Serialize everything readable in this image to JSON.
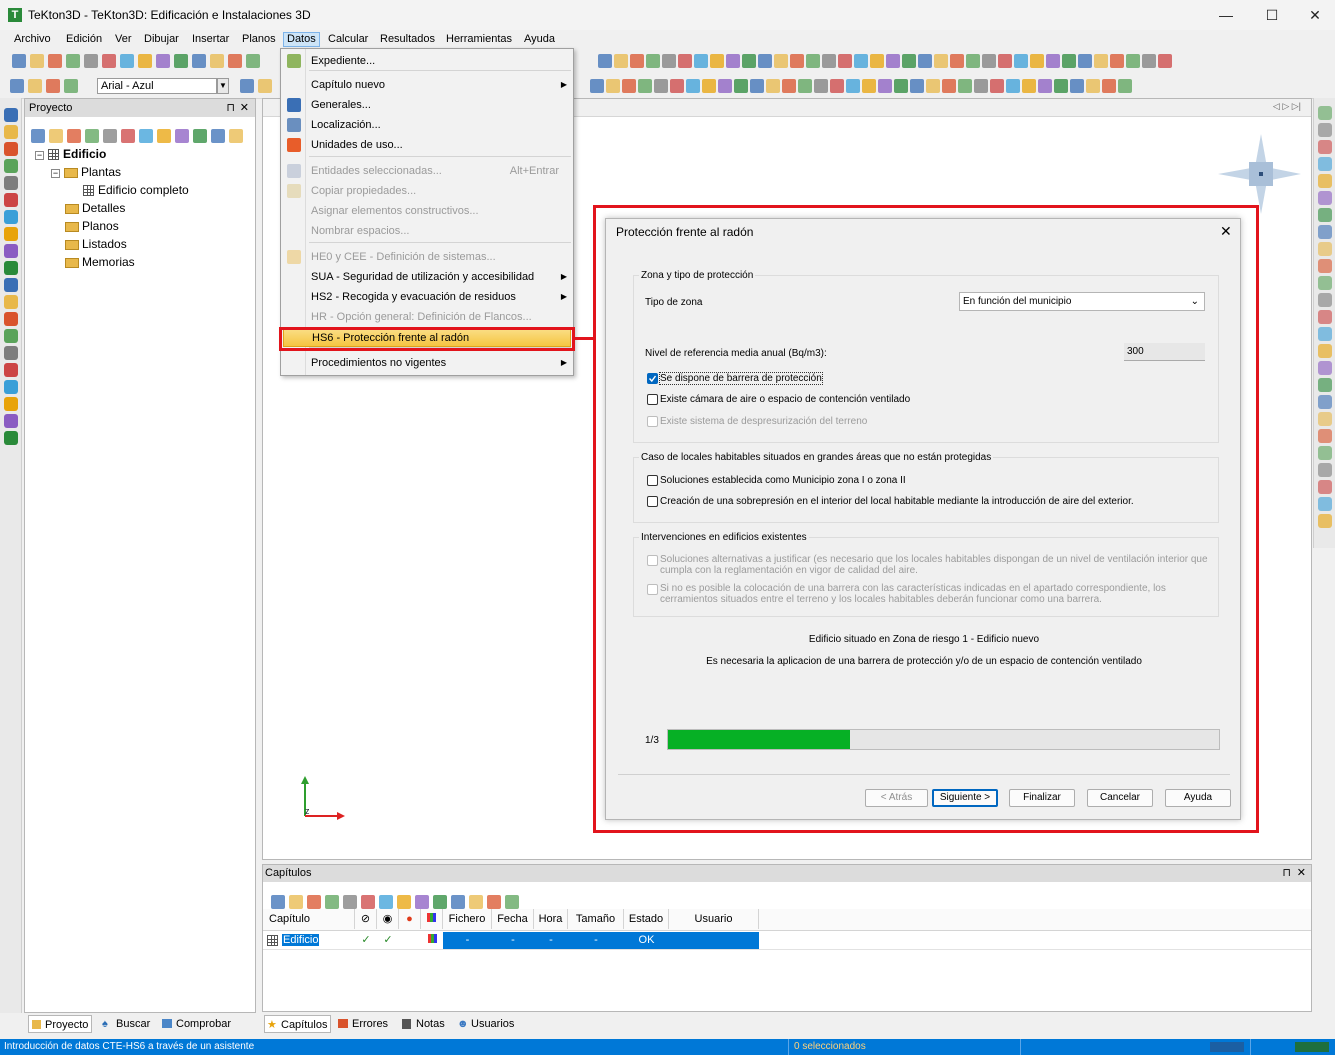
{
  "window": {
    "title": "TeKton3D - TeKton3D: Edificación e Instalaciones 3D",
    "minimize": "—",
    "maximize": "☐",
    "close": "✕"
  },
  "menubar": [
    "Archivo",
    "Edición",
    "Ver",
    "Dibujar",
    "Insertar",
    "Planos",
    "Datos",
    "Calcular",
    "Resultados",
    "Herramientas",
    "Ayuda"
  ],
  "toolbar": {
    "font_select": "Arial - Azul"
  },
  "project_panel": {
    "title": "Proyecto",
    "tree": {
      "root": "Edificio",
      "plantas": "Plantas",
      "edificio_completo": "Edificio completo",
      "detalles": "Detalles",
      "planos": "Planos",
      "listados": "Listados",
      "memorias": "Memorias"
    }
  },
  "datos_menu": {
    "items": [
      {
        "label": "Expediente...",
        "disabled": false
      },
      {
        "label": "Capítulo nuevo",
        "disabled": false,
        "submenu": true
      },
      {
        "label": "Generales...",
        "disabled": false
      },
      {
        "label": "Localización...",
        "disabled": false
      },
      {
        "label": "Unidades de uso...",
        "disabled": false
      },
      {
        "label": "Entidades seleccionadas...",
        "disabled": true,
        "shortcut": "Alt+Entrar"
      },
      {
        "label": "Copiar propiedades...",
        "disabled": true
      },
      {
        "label": "Asignar elementos constructivos...",
        "disabled": true
      },
      {
        "label": "Nombrar espacios...",
        "disabled": true
      },
      {
        "label": "HE0 y CEE - Definición de sistemas...",
        "disabled": true
      },
      {
        "label": "SUA - Seguridad de utilización y accesibilidad",
        "disabled": false,
        "submenu": true
      },
      {
        "label": "HS2 - Recogida y evacuación de residuos",
        "disabled": false,
        "submenu": true
      },
      {
        "label": "HR - Opción general: Definición de Flancos...",
        "disabled": true
      },
      {
        "label": "HS6 - Protección frente al radón",
        "disabled": false,
        "highlighted": true
      },
      {
        "label": "Procedimientos no vigentes",
        "disabled": false,
        "submenu": true
      }
    ]
  },
  "dialog": {
    "title": "Protección frente al radón",
    "group1": {
      "title": "Zona y tipo de protección",
      "tipo_zona_label": "Tipo de zona",
      "tipo_zona_value": "En función del municipio",
      "nivel_label": "Nivel de referencia media anual (Bq/m3):",
      "nivel_value": "300",
      "cb1": "Se dispone de barrera de protección",
      "cb2": "Existe cámara de aire o espacio de contención ventilado",
      "cb3": "Existe sistema de despresurización del terreno"
    },
    "group2": {
      "title": "Caso de locales habitables situados en grandes áreas que no están protegidas",
      "cb1": "Soluciones establecida como Municipio zona I o zona II",
      "cb2": "Creación de una sobrepresión en el interior del local habitable mediante la introducción de aire del exterior."
    },
    "group3": {
      "title": "Intervenciones en edificios existentes",
      "cb1_line1": "Soluciones alternativas a justificar (es necesario que los locales habitables dispongan de un nivel de ventilación interior que",
      "cb1_line2": "cumpla con la reglamentación en vigor de calidad del aire.",
      "cb2_line1": "Si no es posible la colocación de una barrera con las características indicadas en el apartado correspondiente, los",
      "cb2_line2": "cerramientos situados entre el terreno y los locales habitables deberán funcionar como una barrera."
    },
    "info1": "Edificio situado en Zona de riesgo 1 - Edificio nuevo",
    "info2": "Es necesaria la aplicacion de una barrera de protección y/o de un espacio de contención ventilado",
    "progress_label": "1/3",
    "progress_fraction": 0.33,
    "buttons": {
      "back": "< Atrás",
      "next": "Siguiente >",
      "finish": "Finalizar",
      "cancel": "Cancelar",
      "help": "Ayuda"
    }
  },
  "capitulos": {
    "title": "Capítulos",
    "columns": [
      "Capítulo",
      "Fichero",
      "Fecha",
      "Hora",
      "Tamaño",
      "Estado",
      "Usuario"
    ],
    "row": {
      "name": "Edificio",
      "fichero": "-",
      "fecha": "-",
      "hora": "-",
      "tamano": "-",
      "estado": "OK",
      "check": "✓"
    }
  },
  "bottom_tabs_left": [
    "Proyecto",
    "Buscar",
    "Comprobar"
  ],
  "bottom_tabs_right": [
    "Capítulos",
    "Errores",
    "Notas",
    "Usuarios"
  ],
  "status": {
    "text": "Introducción de datos CTE-HS6 a través de un asistente",
    "selected": "0 seleccionados"
  },
  "colors": {
    "accent": "#0078d7",
    "highlight": "#e2141c",
    "progress": "#06b025",
    "menu_hl": "#f5c542"
  }
}
